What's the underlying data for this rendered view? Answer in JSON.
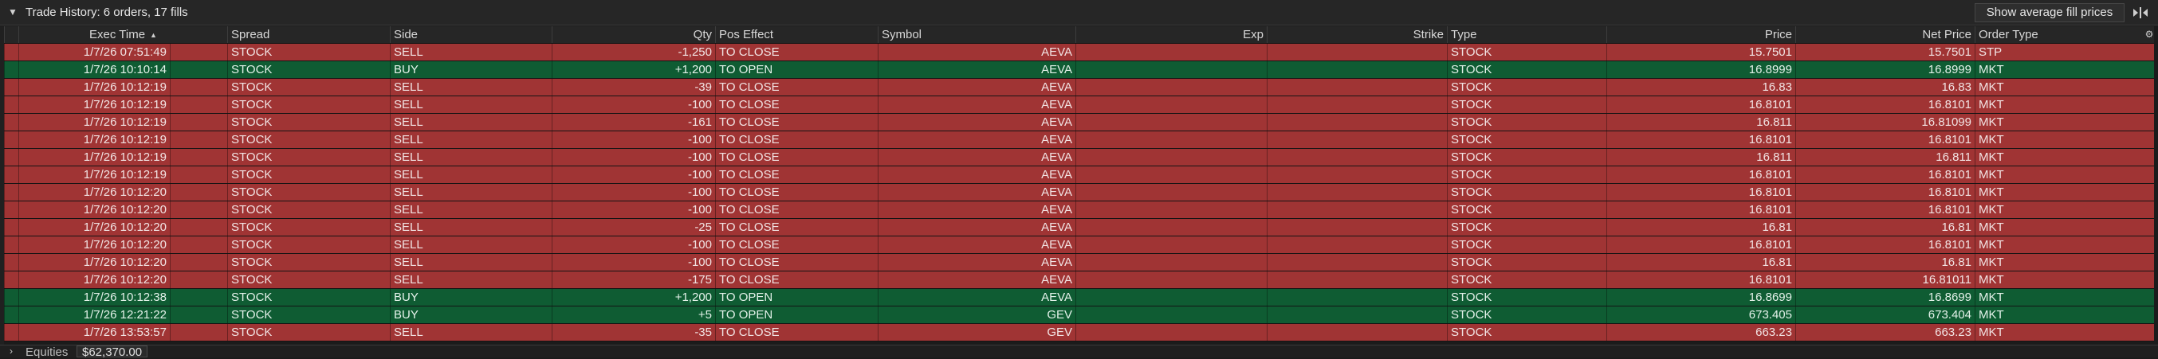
{
  "header": {
    "title": "Trade History: 6 orders, 17 fills",
    "avg_button": "Show average fill prices"
  },
  "columns": {
    "exec_time": "Exec Time",
    "spread": "Spread",
    "side": "Side",
    "qty": "Qty",
    "pos_effect": "Pos Effect",
    "symbol": "Symbol",
    "exp": "Exp",
    "strike": "Strike",
    "type": "Type",
    "price": "Price",
    "net_price": "Net Price",
    "order_type": "Order Type"
  },
  "icons": {
    "collapse": "chevron-down-icon",
    "sort": "sort-ascending-icon",
    "panel": "collapse-panel-icon",
    "settings": "gear-icon",
    "expand": "chevron-right-icon"
  },
  "colors": {
    "sell_row": "#a03434",
    "buy_row": "#0f5c33",
    "header_bg": "#262626",
    "page_bg": "#1b1b1b"
  },
  "rows": [
    {
      "side_class": "sell",
      "exec_time": "1/7/26 07:51:49",
      "spread": "STOCK",
      "side": "SELL",
      "qty": "-1,250",
      "pos_effect": "TO CLOSE",
      "symbol": "AEVA",
      "exp": "",
      "strike": "",
      "type": "STOCK",
      "price": "15.7501",
      "net_price": "15.7501",
      "order_type": "STP"
    },
    {
      "side_class": "buy",
      "exec_time": "1/7/26 10:10:14",
      "spread": "STOCK",
      "side": "BUY",
      "qty": "+1,200",
      "pos_effect": "TO OPEN",
      "symbol": "AEVA",
      "exp": "",
      "strike": "",
      "type": "STOCK",
      "price": "16.8999",
      "net_price": "16.8999",
      "order_type": "MKT"
    },
    {
      "side_class": "sell",
      "exec_time": "1/7/26 10:12:19",
      "spread": "STOCK",
      "side": "SELL",
      "qty": "-39",
      "pos_effect": "TO CLOSE",
      "symbol": "AEVA",
      "exp": "",
      "strike": "",
      "type": "STOCK",
      "price": "16.83",
      "net_price": "16.83",
      "order_type": "MKT"
    },
    {
      "side_class": "sell",
      "exec_time": "1/7/26 10:12:19",
      "spread": "STOCK",
      "side": "SELL",
      "qty": "-100",
      "pos_effect": "TO CLOSE",
      "symbol": "AEVA",
      "exp": "",
      "strike": "",
      "type": "STOCK",
      "price": "16.8101",
      "net_price": "16.8101",
      "order_type": "MKT"
    },
    {
      "side_class": "sell",
      "exec_time": "1/7/26 10:12:19",
      "spread": "STOCK",
      "side": "SELL",
      "qty": "-161",
      "pos_effect": "TO CLOSE",
      "symbol": "AEVA",
      "exp": "",
      "strike": "",
      "type": "STOCK",
      "price": "16.811",
      "net_price": "16.81099",
      "order_type": "MKT"
    },
    {
      "side_class": "sell",
      "exec_time": "1/7/26 10:12:19",
      "spread": "STOCK",
      "side": "SELL",
      "qty": "-100",
      "pos_effect": "TO CLOSE",
      "symbol": "AEVA",
      "exp": "",
      "strike": "",
      "type": "STOCK",
      "price": "16.8101",
      "net_price": "16.8101",
      "order_type": "MKT"
    },
    {
      "side_class": "sell",
      "exec_time": "1/7/26 10:12:19",
      "spread": "STOCK",
      "side": "SELL",
      "qty": "-100",
      "pos_effect": "TO CLOSE",
      "symbol": "AEVA",
      "exp": "",
      "strike": "",
      "type": "STOCK",
      "price": "16.811",
      "net_price": "16.811",
      "order_type": "MKT"
    },
    {
      "side_class": "sell",
      "exec_time": "1/7/26 10:12:19",
      "spread": "STOCK",
      "side": "SELL",
      "qty": "-100",
      "pos_effect": "TO CLOSE",
      "symbol": "AEVA",
      "exp": "",
      "strike": "",
      "type": "STOCK",
      "price": "16.8101",
      "net_price": "16.8101",
      "order_type": "MKT"
    },
    {
      "side_class": "sell",
      "exec_time": "1/7/26 10:12:20",
      "spread": "STOCK",
      "side": "SELL",
      "qty": "-100",
      "pos_effect": "TO CLOSE",
      "symbol": "AEVA",
      "exp": "",
      "strike": "",
      "type": "STOCK",
      "price": "16.8101",
      "net_price": "16.8101",
      "order_type": "MKT"
    },
    {
      "side_class": "sell",
      "exec_time": "1/7/26 10:12:20",
      "spread": "STOCK",
      "side": "SELL",
      "qty": "-100",
      "pos_effect": "TO CLOSE",
      "symbol": "AEVA",
      "exp": "",
      "strike": "",
      "type": "STOCK",
      "price": "16.8101",
      "net_price": "16.8101",
      "order_type": "MKT"
    },
    {
      "side_class": "sell",
      "exec_time": "1/7/26 10:12:20",
      "spread": "STOCK",
      "side": "SELL",
      "qty": "-25",
      "pos_effect": "TO CLOSE",
      "symbol": "AEVA",
      "exp": "",
      "strike": "",
      "type": "STOCK",
      "price": "16.81",
      "net_price": "16.81",
      "order_type": "MKT"
    },
    {
      "side_class": "sell",
      "exec_time": "1/7/26 10:12:20",
      "spread": "STOCK",
      "side": "SELL",
      "qty": "-100",
      "pos_effect": "TO CLOSE",
      "symbol": "AEVA",
      "exp": "",
      "strike": "",
      "type": "STOCK",
      "price": "16.8101",
      "net_price": "16.8101",
      "order_type": "MKT"
    },
    {
      "side_class": "sell",
      "exec_time": "1/7/26 10:12:20",
      "spread": "STOCK",
      "side": "SELL",
      "qty": "-100",
      "pos_effect": "TO CLOSE",
      "symbol": "AEVA",
      "exp": "",
      "strike": "",
      "type": "STOCK",
      "price": "16.81",
      "net_price": "16.81",
      "order_type": "MKT"
    },
    {
      "side_class": "sell",
      "exec_time": "1/7/26 10:12:20",
      "spread": "STOCK",
      "side": "SELL",
      "qty": "-175",
      "pos_effect": "TO CLOSE",
      "symbol": "AEVA",
      "exp": "",
      "strike": "",
      "type": "STOCK",
      "price": "16.8101",
      "net_price": "16.81011",
      "order_type": "MKT"
    },
    {
      "side_class": "buy",
      "exec_time": "1/7/26 10:12:38",
      "spread": "STOCK",
      "side": "BUY",
      "qty": "+1,200",
      "pos_effect": "TO OPEN",
      "symbol": "AEVA",
      "exp": "",
      "strike": "",
      "type": "STOCK",
      "price": "16.8699",
      "net_price": "16.8699",
      "order_type": "MKT"
    },
    {
      "side_class": "buy",
      "exec_time": "1/7/26 12:21:22",
      "spread": "STOCK",
      "side": "BUY",
      "qty": "+5",
      "pos_effect": "TO OPEN",
      "symbol": "GEV",
      "exp": "",
      "strike": "",
      "type": "STOCK",
      "price": "673.405",
      "net_price": "673.404",
      "order_type": "MKT"
    },
    {
      "side_class": "sell",
      "exec_time": "1/7/26 13:53:57",
      "spread": "STOCK",
      "side": "SELL",
      "qty": "-35",
      "pos_effect": "TO CLOSE",
      "symbol": "GEV",
      "exp": "",
      "strike": "",
      "type": "STOCK",
      "price": "663.23",
      "net_price": "663.23",
      "order_type": "MKT"
    }
  ],
  "footer": {
    "label": "Equities",
    "value": "$62,370.00"
  }
}
